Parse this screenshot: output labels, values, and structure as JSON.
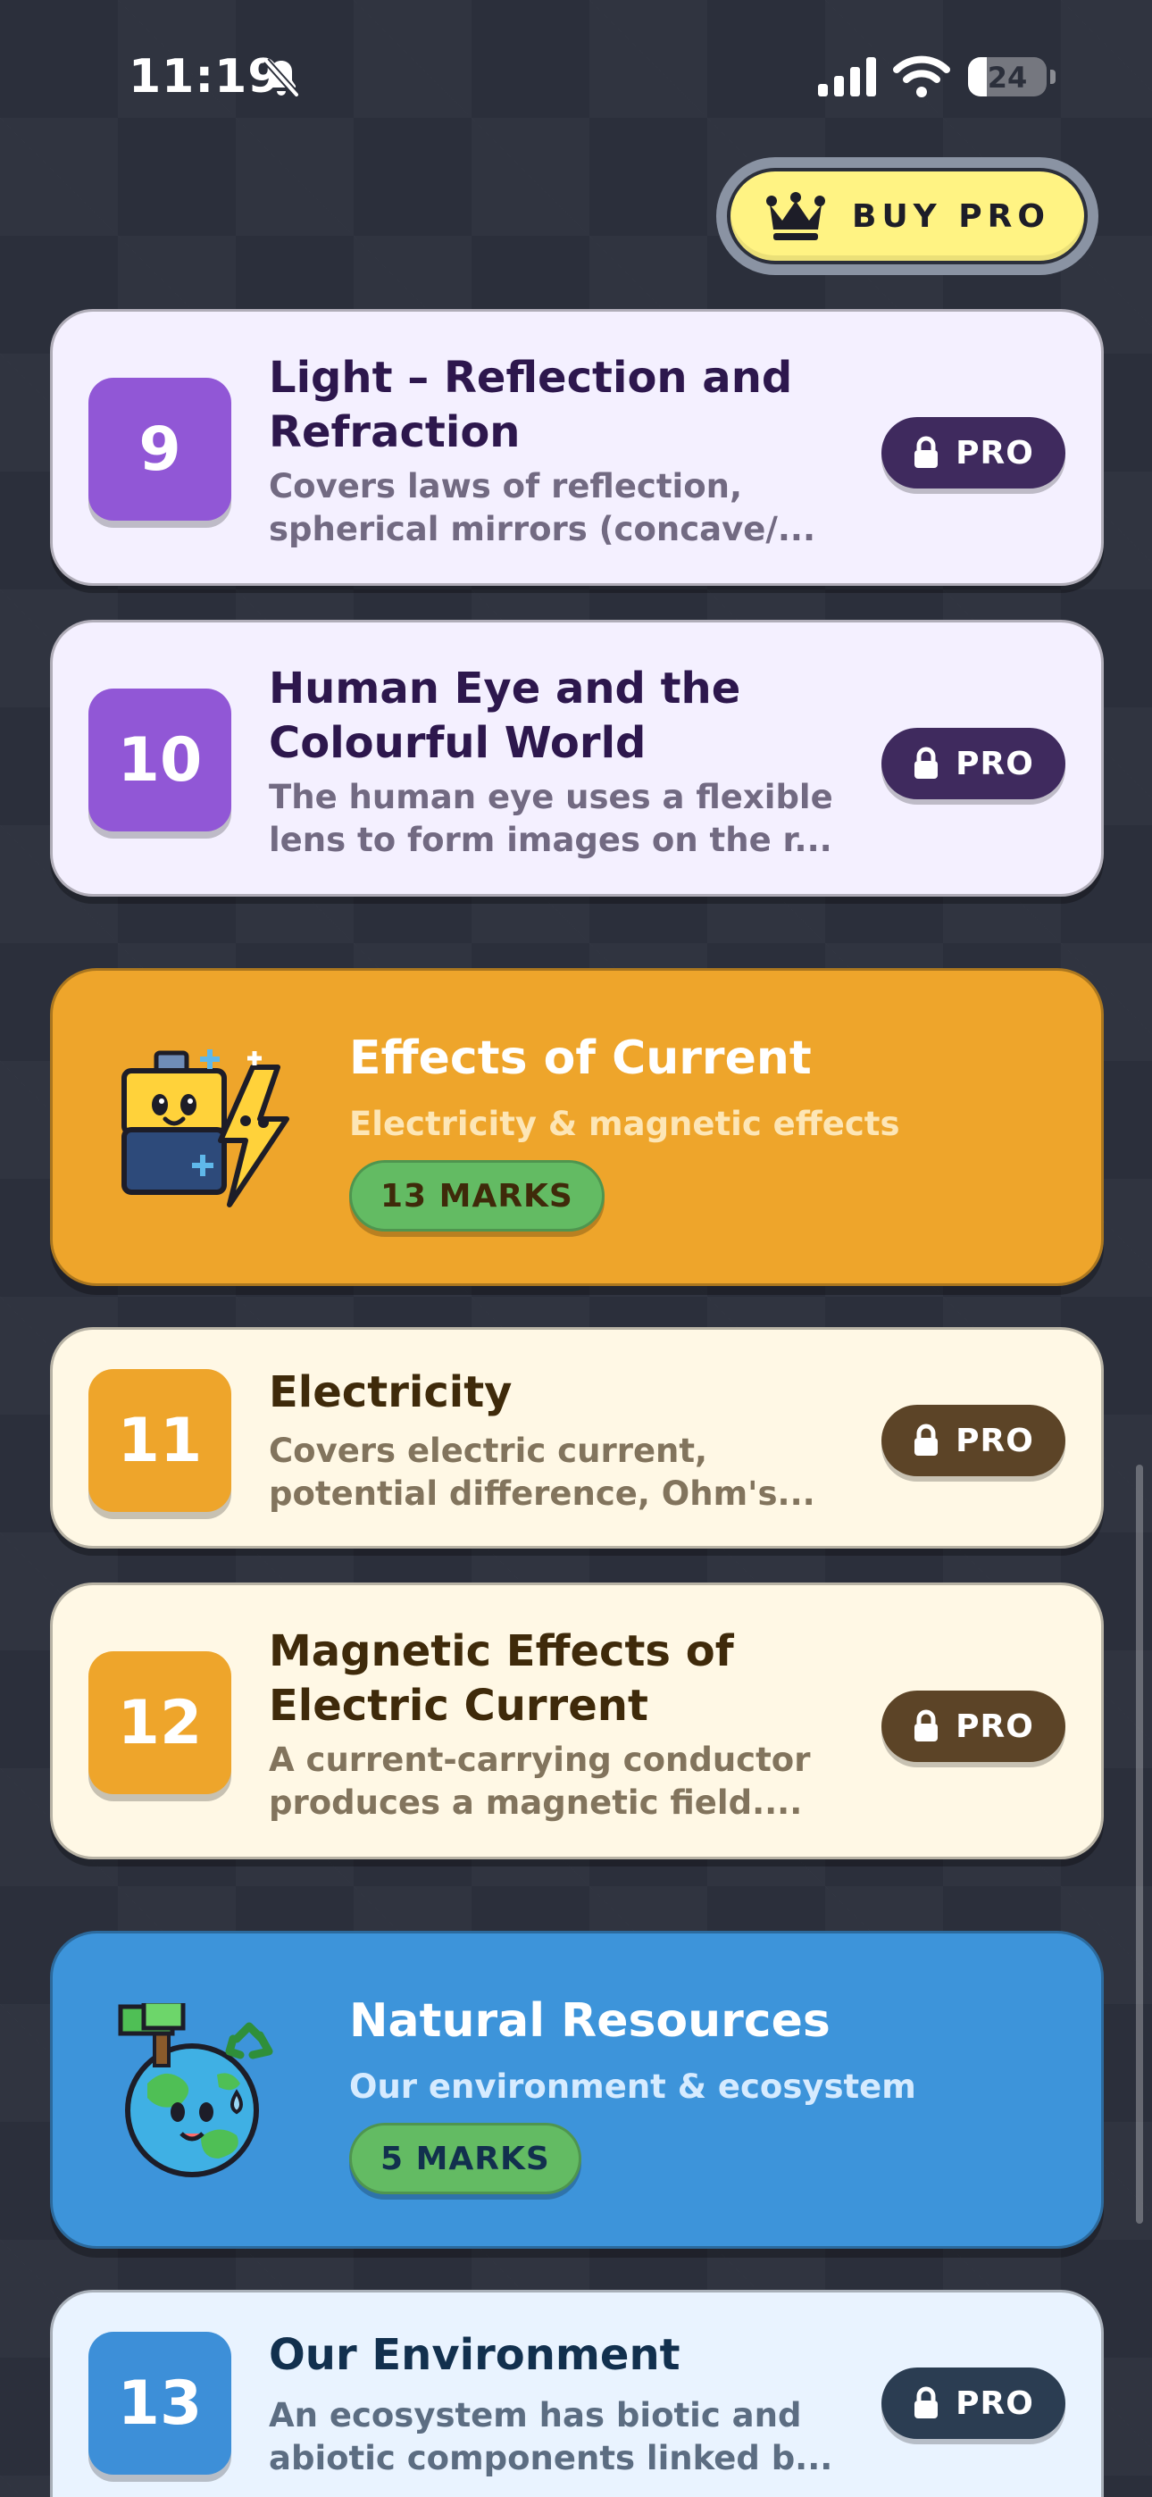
{
  "status_bar": {
    "time": "11:19",
    "battery": "24",
    "icons": [
      "bell-slash-icon",
      "cellular-signal-icon",
      "wifi-icon",
      "battery-icon"
    ]
  },
  "header": {
    "buy_pro_label": "BUY PRO",
    "buy_pro_icon": "crown-icon"
  },
  "colors": {
    "background": "#2b2f3b",
    "purple_accent": "#9157d6",
    "amber_accent": "#eea52b",
    "blue_accent": "#3d8fd8",
    "marks_green": "#63bb63",
    "buy_pro_yellow": "#fff383"
  },
  "chapters": [
    {
      "number": "9",
      "title": "Light – Reflection and Refraction",
      "description": "Covers laws of reflection, spherical mirrors (concave/...",
      "badge": "PRO"
    },
    {
      "number": "10",
      "title": "Human Eye and the Colourful World",
      "description": "The human eye uses a flexible lens to form images on the r...",
      "badge": "PRO"
    },
    {
      "number": "11",
      "title": "Electricity",
      "description": "Covers electric current, potential difference, Ohm's...",
      "badge": "PRO"
    },
    {
      "number": "12",
      "title": "Magnetic Effects of Electric Current",
      "description": "A current-carrying conductor produces a magnetic field....",
      "badge": "PRO"
    },
    {
      "number": "13",
      "title": "Our Environment",
      "description": "An ecosystem has biotic and abiotic components linked b...",
      "badge": "PRO"
    }
  ],
  "sections": [
    {
      "title": "Effects of Current",
      "subtitle": "Electricity & magnetic effects",
      "marks": "13 MARKS",
      "icon": "battery-lightning-mascot-icon"
    },
    {
      "title": "Natural Resources",
      "subtitle": "Our environment & ecosystem",
      "marks": "5 MARKS",
      "icon": "earth-tree-mascot-icon"
    }
  ]
}
